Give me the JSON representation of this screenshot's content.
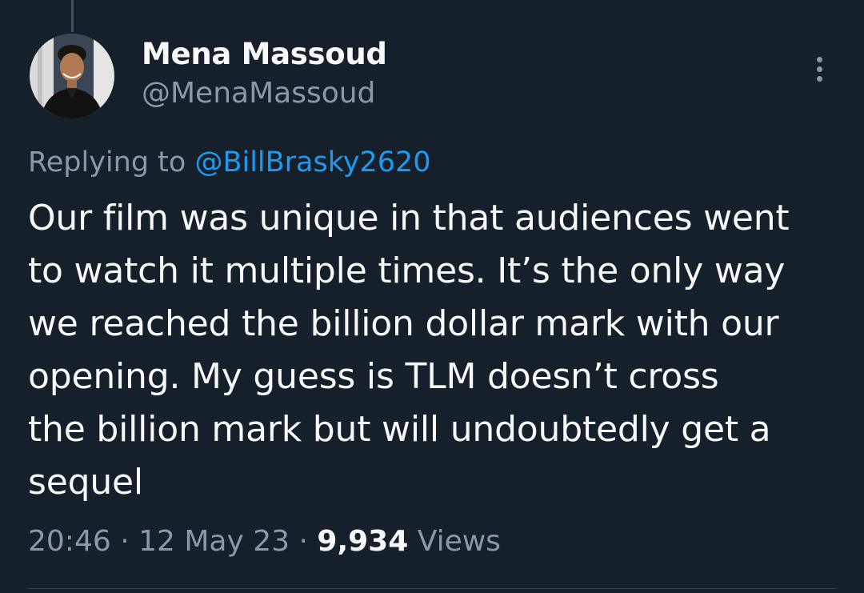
{
  "author": {
    "display_name": "Mena Massoud",
    "handle": "@MenaMassoud"
  },
  "reply": {
    "prefix": "Replying to",
    "mention": "@BillBrasky2620"
  },
  "tweet": {
    "text_lines": [
      "Our film was unique in that audiences went",
      "to watch it multiple times. It’s the only way",
      "we reached the billion dollar mark with our",
      "opening. My guess is TLM doesn’t cross",
      "the billion mark but will undoubtedly get a",
      "sequel"
    ]
  },
  "meta": {
    "time": "20:46",
    "separator": "·",
    "date": "12 May 23",
    "views_count": "9,934",
    "views_label": "Views"
  },
  "icons": {
    "avatar": "profile-photo",
    "more": "more-vertical-icon"
  },
  "colors": {
    "background": "#15202b",
    "primary_text": "#f7f9f9",
    "secondary_text": "#8b98a5",
    "link": "#1d9bf0"
  }
}
